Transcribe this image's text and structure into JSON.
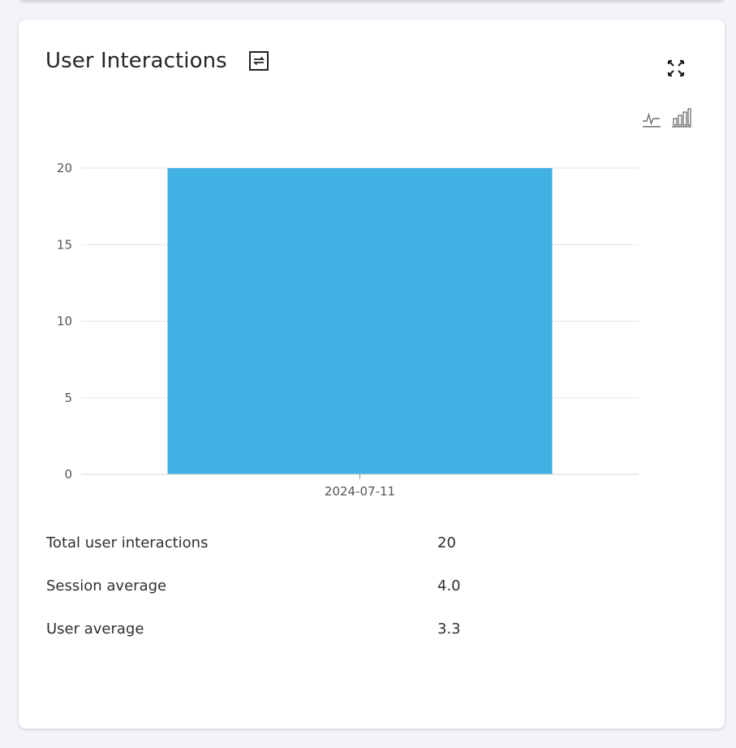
{
  "widget": {
    "title": "User Interactions",
    "icons": {
      "title_icon": "swap-icon",
      "expand": "expand-icon",
      "line_toggle": "line-chart-icon",
      "bar_toggle": "bar-chart-icon"
    }
  },
  "chart_data": {
    "type": "bar",
    "categories": [
      "2024-07-11"
    ],
    "values": [
      20
    ],
    "ylim": [
      0,
      20
    ],
    "yticks": [
      "0",
      "5",
      "10",
      "15",
      "20"
    ],
    "grid": true,
    "bar_color": "#41b0e3",
    "title": "",
    "xlabel": "",
    "ylabel": ""
  },
  "stats": [
    {
      "label": "Total user interactions",
      "value": "20"
    },
    {
      "label": "Session average",
      "value": "4.0"
    },
    {
      "label": "User average",
      "value": "3.3"
    }
  ]
}
